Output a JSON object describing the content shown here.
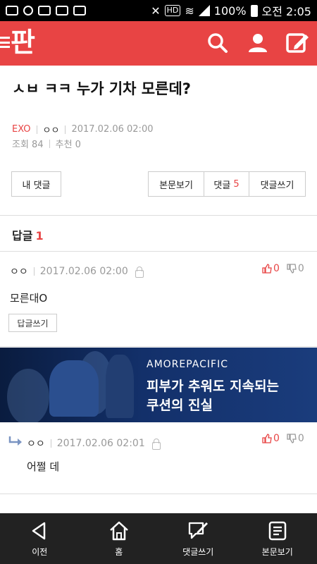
{
  "status_bar": {
    "hd_label": "HD",
    "battery": "100%",
    "time": "오전 2:05"
  },
  "header": {
    "logo": "판",
    "icons": [
      "menu-icon",
      "search-icon",
      "user-icon",
      "edit-icon"
    ]
  },
  "article": {
    "title": "ㅅㅂ ㅋㅋ 누가 기차 모른데?",
    "category": "EXO",
    "author": "ㅇㅇ",
    "datetime": "2017.02.06 02:00",
    "views_label": "조회 84",
    "recommend_label": "추천 0"
  },
  "actions": {
    "my_comments": "내 댓글",
    "view_body": "본문보기",
    "comments_label": "댓글",
    "comments_count": "5",
    "write_comment": "댓글쓰기"
  },
  "replies": {
    "heading": "답글",
    "count": "1"
  },
  "comments": [
    {
      "author": "ㅇㅇ",
      "datetime": "2017.02.06 02:00",
      "text": "모른대O",
      "up": "0",
      "down": "0",
      "reply_button": "답글쓰기"
    },
    {
      "author": "ㅇㅇ",
      "datetime": "2017.02.06 02:01",
      "text": "어쩔 데",
      "up": "0",
      "down": "0"
    }
  ],
  "ad": {
    "brand": "AMOREPACIFIC",
    "line1": "피부가 추워도 지속되는",
    "line2": "쿠션의 진실"
  },
  "bottom_nav": {
    "prev": "이전",
    "home": "홈",
    "write_comment": "댓글쓰기",
    "view_body": "본문보기"
  },
  "colors": {
    "accent": "#e84444",
    "nav_bg": "#222222"
  }
}
